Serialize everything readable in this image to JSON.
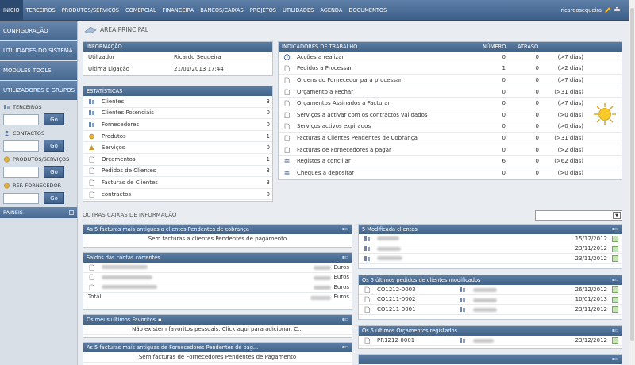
{
  "nav": {
    "items": [
      "INICIO",
      "TERCEIROS",
      "PRODUTOS/SERVIÇOS",
      "COMERCIAL",
      "FINANCEIRA",
      "BANCOS/CAIXAS",
      "PROJETOS",
      "UTILIDADES",
      "AGENDA",
      "DOCUMENTOS"
    ],
    "active": "INICIO",
    "user": "ricardosequeira"
  },
  "sidebar": {
    "buttons": [
      "CONFIGURAÇÃO",
      "UTILIDADES DO SISTEMA",
      "MODULES TOOLS",
      "UTILIZADORES E GRUPOS"
    ],
    "searches": [
      {
        "label": "TERCEIROS",
        "go": "Go"
      },
      {
        "label": "CONTACTOS",
        "go": "Go"
      },
      {
        "label": "PRODUTOS/SERVIÇOS",
        "go": "Go"
      },
      {
        "label": "REF. FORNECEDOR",
        "go": "Go"
      }
    ],
    "panel": "PAINEIS"
  },
  "area_title": "ÁREA PRINCIPAL",
  "info": {
    "title": "INFORMAÇÃO",
    "rows": [
      {
        "k": "Utilizador",
        "v": "Ricardo Sequeira"
      },
      {
        "k": "Ultima Ligação",
        "v": "21/01/2013 17:44"
      }
    ]
  },
  "stats": {
    "title": "ESTATÍSTICAS",
    "rows": [
      {
        "label": "Clientes",
        "value": "3"
      },
      {
        "label": "Clientes Potenciais",
        "value": "0"
      },
      {
        "label": "Fornecedores",
        "value": "0"
      },
      {
        "label": "Produtos",
        "value": "1"
      },
      {
        "label": "Serviços",
        "value": "0"
      },
      {
        "label": "Orçamentos",
        "value": "1"
      },
      {
        "label": "Pedidos de Clientes",
        "value": "3"
      },
      {
        "label": "Facturas de Clientes",
        "value": "3"
      },
      {
        "label": "contractos",
        "value": "0"
      }
    ]
  },
  "indicators": {
    "title": "INDICADORES DE TRABALHO",
    "col_numero": "NÚMERO",
    "col_atraso": "ATRASO",
    "rows": [
      {
        "label": "Acções a realizar",
        "numero": "0",
        "atraso": "0",
        "dias": "(>7 dias)"
      },
      {
        "label": "Pedidos a Processar",
        "numero": "1",
        "atraso": "0",
        "dias": "(>2 dias)"
      },
      {
        "label": "Ordens do Fornecedor para processar",
        "numero": "0",
        "atraso": "0",
        "dias": "(>7 dias)"
      },
      {
        "label": "Orçamento a Fechar",
        "numero": "0",
        "atraso": "0",
        "dias": "(>31 dias)"
      },
      {
        "label": "Orçamentos Assinados a Facturar",
        "numero": "0",
        "atraso": "0",
        "dias": "(>7 dias)"
      },
      {
        "label": "Serviços a activar com os contractos validados",
        "numero": "0",
        "atraso": "0",
        "dias": "(>0 dias)"
      },
      {
        "label": "Serviços activos expirados",
        "numero": "0",
        "atraso": "0",
        "dias": "(>0 dias)"
      },
      {
        "label": "Facturas a Clientes Pendentes de Cobrança",
        "numero": "0",
        "atraso": "0",
        "dias": "(>31 dias)"
      },
      {
        "label": "Facturas de Fornecedores a pagar",
        "numero": "0",
        "atraso": "0",
        "dias": "(>2 dias)"
      },
      {
        "label": "Registos a conciliar",
        "numero": "6",
        "atraso": "0",
        "dias": "(>62 dias)"
      },
      {
        "label": "Cheques a depositar",
        "numero": "0",
        "atraso": "0",
        "dias": "(>0 dias)"
      }
    ]
  },
  "other_title": "OUTRAS CAIXAS DE INFORMAÇÃO",
  "boxes": {
    "oldest_clients": {
      "title": "As 5 facturas mais antiguas a clientes Pendentes de cobrança",
      "empty": "Sem facturas a clientes Pendentes de pagamento"
    },
    "balances": {
      "title": "Saldos das contas correntes",
      "currency": "Euros",
      "total": "Total",
      "row_count": 3
    },
    "favorites": {
      "title": "Os meus ultimos Favoritos",
      "empty": "Não existem favoritos pessoais. Click aqui para adicionar. C..."
    },
    "oldest_suppliers": {
      "title": "As 5 facturas mais antiguas de Fornecedores Pendentes de pag...",
      "empty": "Sem facturas de Fornecedores Pendentes de Pagamento"
    },
    "modified_clients": {
      "title": "5 Modificada clientes",
      "dates": [
        "15/12/2012",
        "23/11/2012",
        "23/11/2012"
      ]
    },
    "orders": {
      "title": "Os 5 últimos pedidos de clientes modificados",
      "rows": [
        {
          "ref": "CO1212-0003",
          "date": "26/12/2012"
        },
        {
          "ref": "CO1211-0002",
          "date": "10/01/2013"
        },
        {
          "ref": "CO1211-0001",
          "date": "23/11/2012"
        }
      ]
    },
    "quotes": {
      "title": "Os 5 últimos Orçamentos registados",
      "rows": [
        {
          "ref": "PR1212-0001",
          "date": "23/12/2012"
        }
      ]
    }
  },
  "colors": {
    "nav": "#3c5f89",
    "panel_head": "#436487",
    "accent_go": "#3d5f88"
  }
}
